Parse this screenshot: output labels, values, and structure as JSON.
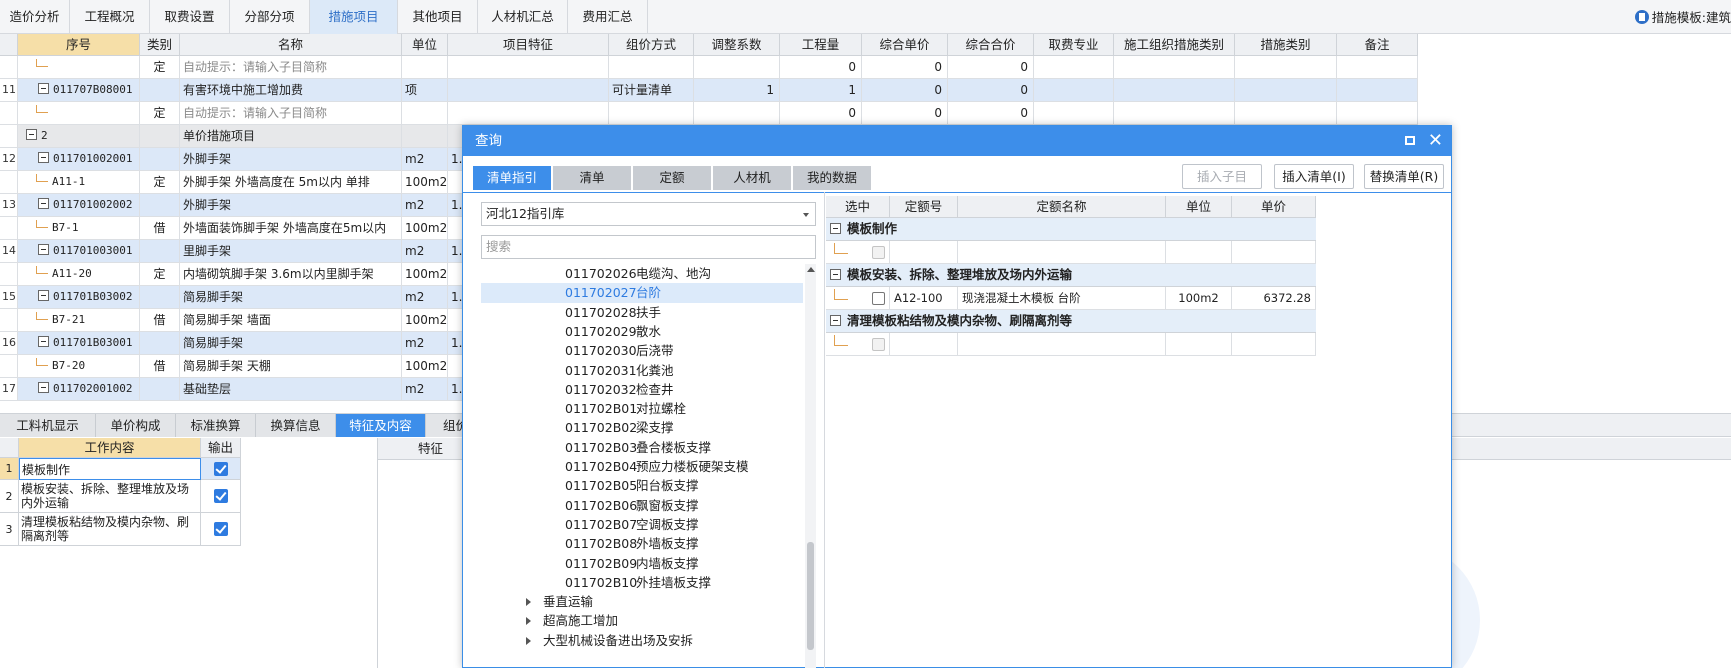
{
  "top_tabs": [
    "造价分析",
    "工程概况",
    "取费设置",
    "分部分项",
    "措施项目",
    "其他项目",
    "人材机汇总",
    "费用汇总"
  ],
  "top_right_label": "措施模板:建筑",
  "grid_headers": [
    "序号",
    "类别",
    "名称",
    "单位",
    "项目特征",
    "组价方式",
    "调整系数",
    "工程量",
    "综合单价",
    "综合合价",
    "取费专业",
    "施工组织措施类别",
    "措施类别",
    "备注"
  ],
  "grid_rows": [
    {
      "rownum": "",
      "code": "",
      "type": "定",
      "name": "自动提示：请输入子目简称",
      "unit": "",
      "feature": "",
      "method": "",
      "coef": "",
      "qty": "0",
      "price": "0",
      "total": "0",
      "style": "sub"
    },
    {
      "rownum": "11",
      "code": "011707B08001",
      "type": "",
      "name": "有害环境中施工增加费",
      "unit": "项",
      "feature": "",
      "method": "可计量清单",
      "coef": "1",
      "qty": "1",
      "price": "0",
      "total": "0",
      "style": "blue"
    },
    {
      "rownum": "",
      "code": "",
      "type": "定",
      "name": "自动提示：请输入子目简称",
      "unit": "",
      "feature": "",
      "method": "",
      "coef": "",
      "qty": "0",
      "price": "0",
      "total": "0",
      "style": "sub"
    },
    {
      "rownum": "",
      "code": "2",
      "type": "",
      "name": "单价措施项目",
      "unit": "",
      "feature": "",
      "method": "",
      "coef": "",
      "qty": "",
      "price": "",
      "total": "",
      "style": "grey"
    },
    {
      "rownum": "12",
      "code": "011701002001",
      "type": "",
      "name": "外脚手架",
      "unit": "m2",
      "feature": "1.",
      "method": "",
      "coef": "",
      "qty": "",
      "price": "",
      "total": "",
      "style": "blue"
    },
    {
      "rownum": "",
      "code": "A11-1",
      "type": "定",
      "name": "外脚手架 外墙高度在 5m以内 单排",
      "unit": "100m2",
      "feature": "",
      "method": "",
      "coef": "",
      "qty": "",
      "price": "",
      "total": "",
      "style": "child"
    },
    {
      "rownum": "13",
      "code": "011701002002",
      "type": "",
      "name": "外脚手架",
      "unit": "m2",
      "feature": "1.",
      "method": "",
      "coef": "",
      "qty": "",
      "price": "",
      "total": "",
      "style": "blue"
    },
    {
      "rownum": "",
      "code": "B7-1",
      "type": "借",
      "name": "外墙面装饰脚手架 外墙高度在5m以内",
      "unit": "100m2",
      "feature": "",
      "method": "",
      "coef": "",
      "qty": "",
      "price": "",
      "total": "",
      "style": "child"
    },
    {
      "rownum": "14",
      "code": "011701003001",
      "type": "",
      "name": "里脚手架",
      "unit": "m2",
      "feature": "1.",
      "method": "",
      "coef": "",
      "qty": "",
      "price": "",
      "total": "",
      "style": "blue"
    },
    {
      "rownum": "",
      "code": "A11-20",
      "type": "定",
      "name": "内墙砌筑脚手架 3.6m以内里脚手架",
      "unit": "100m2",
      "feature": "",
      "method": "",
      "coef": "",
      "qty": "",
      "price": "",
      "total": "",
      "style": "child"
    },
    {
      "rownum": "15",
      "code": "011701B03002",
      "type": "",
      "name": "简易脚手架",
      "unit": "m2",
      "feature": "1.",
      "method": "",
      "coef": "",
      "qty": "",
      "price": "",
      "total": "",
      "style": "blue"
    },
    {
      "rownum": "",
      "code": "B7-21",
      "type": "借",
      "name": "简易脚手架 墙面",
      "unit": "100m2",
      "feature": "",
      "method": "",
      "coef": "",
      "qty": "",
      "price": "",
      "total": "",
      "style": "child"
    },
    {
      "rownum": "16",
      "code": "011701B03001",
      "type": "",
      "name": "简易脚手架",
      "unit": "m2",
      "feature": "1.",
      "method": "",
      "coef": "",
      "qty": "",
      "price": "",
      "total": "",
      "style": "blue"
    },
    {
      "rownum": "",
      "code": "B7-20",
      "type": "借",
      "name": "简易脚手架 天棚",
      "unit": "100m2",
      "feature": "",
      "method": "",
      "coef": "",
      "qty": "",
      "price": "",
      "total": "",
      "style": "child"
    },
    {
      "rownum": "17",
      "code": "011702001002",
      "type": "",
      "name": "基础垫层",
      "unit": "m2",
      "feature": "1.",
      "method": "",
      "coef": "",
      "qty": "",
      "price": "",
      "total": "",
      "style": "blue"
    }
  ],
  "bottom_tabs": [
    "工料机显示",
    "单价构成",
    "标准换算",
    "换算信息",
    "特征及内容",
    "组价"
  ],
  "work_table": {
    "headers": [
      "工作内容",
      "输出"
    ],
    "rows": [
      {
        "n": "1",
        "text": "模板制作",
        "checked": true
      },
      {
        "n": "2",
        "text": "模板安装、拆除、整理堆放及场内外运输",
        "checked": true
      },
      {
        "n": "3",
        "text": "清理模板粘结物及模内杂物、刷隔离剂等",
        "checked": true
      }
    ]
  },
  "feature_header": "特征",
  "dialog": {
    "title": "查询",
    "tabs": [
      "清单指引",
      "清单",
      "定额",
      "人材机",
      "我的数据"
    ],
    "buttons": {
      "insert_sub": "插入子目",
      "insert_list": "插入清单(I)",
      "replace_list": "替换清单(R)"
    },
    "library": "河北12指引库",
    "search_placeholder": "搜索",
    "tree_items": [
      {
        "code": "011702026",
        "name": "电缆沟、地沟"
      },
      {
        "code": "011702027",
        "name": "台阶"
      },
      {
        "code": "011702028",
        "name": "扶手"
      },
      {
        "code": "011702029",
        "name": "散水"
      },
      {
        "code": "011702030",
        "name": "后浇带"
      },
      {
        "code": "011702031",
        "name": "化粪池"
      },
      {
        "code": "011702032",
        "name": "检查井"
      },
      {
        "code": "011702B01",
        "name": "对拉螺栓"
      },
      {
        "code": "011702B02",
        "name": "梁支撑"
      },
      {
        "code": "011702B03",
        "name": "叠合楼板支撑"
      },
      {
        "code": "011702B04",
        "name": "预应力楼板硬架支模"
      },
      {
        "code": "011702B05",
        "name": "阳台板支撑"
      },
      {
        "code": "011702B06",
        "name": "飘窗板支撑"
      },
      {
        "code": "011702B07",
        "name": "空调板支撑"
      },
      {
        "code": "011702B08",
        "name": "外墙板支撑"
      },
      {
        "code": "011702B09",
        "name": "内墙板支撑"
      },
      {
        "code": "011702B10",
        "name": "外挂墙板支撑"
      }
    ],
    "selected_tree_index": 1,
    "tree_groups": [
      "垂直运输",
      "超高施工增加",
      "大型机械设备进出场及安拆"
    ],
    "quota_headers": [
      "选中",
      "定额号",
      "定额名称",
      "单位",
      "单价"
    ],
    "quota_groups": [
      {
        "title": "模板制作",
        "rows": [
          {
            "code": "",
            "name": "",
            "unit": "",
            "price": "",
            "enabled": false
          }
        ]
      },
      {
        "title": "模板安装、拆除、整理堆放及场内外运输",
        "rows": [
          {
            "code": "A12-100",
            "name": "现浇混凝土木模板 台阶",
            "unit": "100m2",
            "price": "6372.28",
            "enabled": true
          }
        ]
      },
      {
        "title": "清理模板粘结物及模内杂物、刷隔离剂等",
        "rows": [
          {
            "code": "",
            "name": "",
            "unit": "",
            "price": "",
            "enabled": false
          }
        ]
      }
    ]
  }
}
